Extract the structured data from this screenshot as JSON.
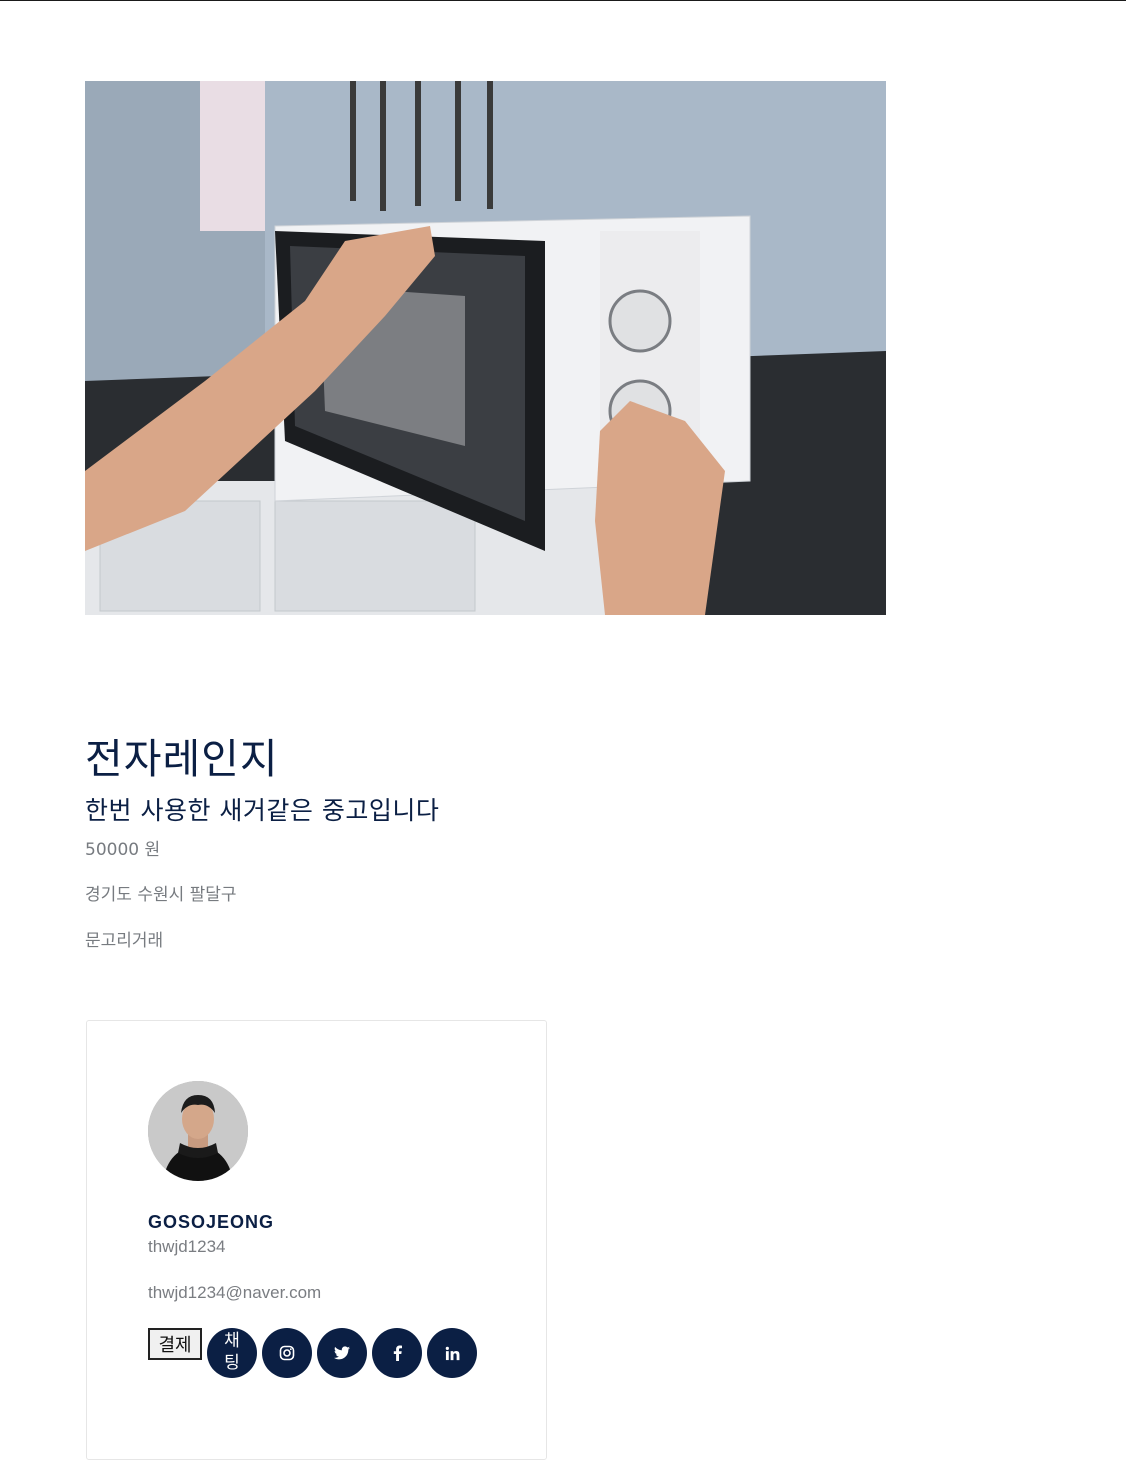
{
  "product": {
    "image_alt": "microwave-photo",
    "title": "전자레인지",
    "description": "한번 사용한 새거같은 중고입니다",
    "price": "50000 원",
    "location": "경기도 수원시 팔달구",
    "trade_method": "문고리거래"
  },
  "seller": {
    "name": "GOSOJEONG",
    "user_id": "thwjd1234",
    "email": "thwjd1234@naver.com"
  },
  "actions": {
    "pay_label": "결제",
    "chat_label_line1": "채",
    "chat_label_line2": "팅",
    "social_icons": [
      "instagram-icon",
      "twitter-icon",
      "facebook-icon",
      "linkedin-icon"
    ]
  },
  "colors": {
    "accent": "#0b1f44",
    "muted_text": "#777b80"
  }
}
